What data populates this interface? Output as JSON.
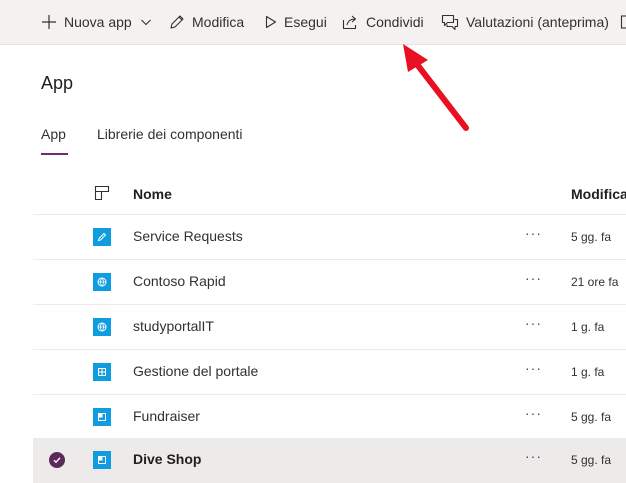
{
  "toolbar": {
    "new_app": "Nuova app",
    "edit": "Modifica",
    "run": "Esegui",
    "share": "Condividi",
    "reviews": "Valutazioni (anteprima)"
  },
  "page": {
    "title": "App",
    "tabs": [
      {
        "label": "App",
        "active": true
      },
      {
        "label": "Librerie dei componenti",
        "active": false
      }
    ]
  },
  "table": {
    "columns": {
      "name": "Nome",
      "modified": "Modifica"
    },
    "rows": [
      {
        "name": "Service Requests",
        "modified": "5 gg. fa",
        "icon": "pencil-icon",
        "selected": false
      },
      {
        "name": "Contoso Rapid",
        "modified": "21 ore fa",
        "icon": "globe-icon",
        "selected": false
      },
      {
        "name": "studyportalIT",
        "modified": "1 g. fa",
        "icon": "globe-icon",
        "selected": false
      },
      {
        "name": "Gestione del portale",
        "modified": "1 g. fa",
        "icon": "grid-app-icon",
        "selected": false
      },
      {
        "name": "Fundraiser",
        "modified": "5 gg. fa",
        "icon": "canvas-app-icon",
        "selected": false
      },
      {
        "name": "Dive Shop",
        "modified": "5 gg. fa",
        "icon": "canvas-app-icon",
        "selected": true
      }
    ],
    "more_label": "···"
  },
  "colors": {
    "accent": "#742774",
    "app_icon": "#0f9ddf",
    "annotation_arrow": "#e81123",
    "toolbar_bg": "#f3f2f1",
    "selected_row_bg": "#edebe9"
  }
}
